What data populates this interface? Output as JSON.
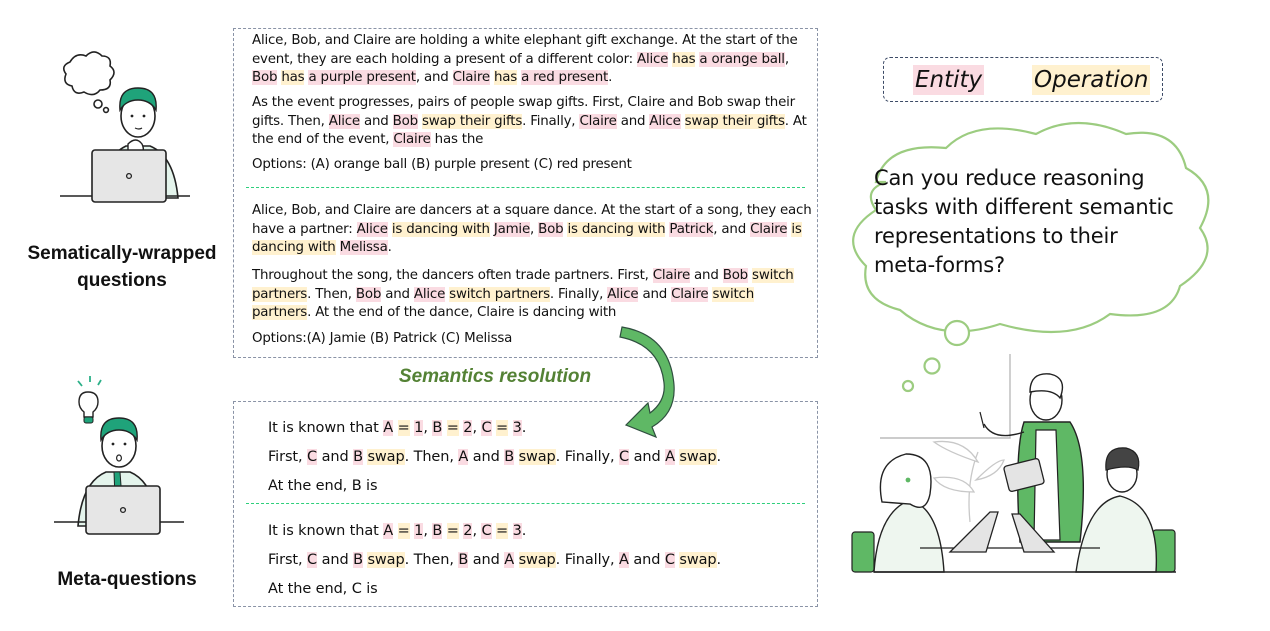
{
  "left_panel": {
    "top_label_line1": "Sematically-wrapped",
    "top_label_line2": "questions",
    "bottom_label": "Meta-questions"
  },
  "highlight_colors": {
    "entity": "#fadbe2",
    "operation": "#fff1cf",
    "separator": "#2ecf7c",
    "arrow": "#5fb865",
    "accent_text": "#548235",
    "cloud_stroke": "#9ccc80"
  },
  "wrapped_questions": {
    "q1": {
      "p1": [
        {
          "t": "Alice, Bob, and Claire are holding a white elephant gift exchange. At the start of the event, they are each holding a present of a different color: ",
          "k": ""
        },
        {
          "t": "Alice",
          "k": "ent"
        },
        {
          "t": " ",
          "k": ""
        },
        {
          "t": "has",
          "k": "op"
        },
        {
          "t": " ",
          "k": ""
        },
        {
          "t": "a orange ball",
          "k": "ent"
        },
        {
          "t": ", ",
          "k": ""
        },
        {
          "t": "Bob",
          "k": "ent"
        },
        {
          "t": " ",
          "k": ""
        },
        {
          "t": "has",
          "k": "op"
        },
        {
          "t": " ",
          "k": ""
        },
        {
          "t": "a purple present",
          "k": "ent"
        },
        {
          "t": ", and ",
          "k": ""
        },
        {
          "t": "Claire",
          "k": "ent"
        },
        {
          "t": " ",
          "k": ""
        },
        {
          "t": "has",
          "k": "op"
        },
        {
          "t": " ",
          "k": ""
        },
        {
          "t": "a red present",
          "k": "ent"
        },
        {
          "t": ".",
          "k": ""
        }
      ],
      "p2": [
        {
          "t": "As the event progresses, pairs of people swap gifts. First, Claire and Bob swap their gifts. Then, ",
          "k": ""
        },
        {
          "t": "Alice",
          "k": "ent"
        },
        {
          "t": " and ",
          "k": ""
        },
        {
          "t": "Bob",
          "k": "ent"
        },
        {
          "t": " ",
          "k": ""
        },
        {
          "t": "swap their gifts",
          "k": "op"
        },
        {
          "t": ". Finally, ",
          "k": ""
        },
        {
          "t": "Claire",
          "k": "ent"
        },
        {
          "t": " and ",
          "k": ""
        },
        {
          "t": "Alice",
          "k": "ent"
        },
        {
          "t": " ",
          "k": ""
        },
        {
          "t": "swap their gifts",
          "k": "op"
        },
        {
          "t": ". At the end of the event, ",
          "k": ""
        },
        {
          "t": "Claire",
          "k": "ent"
        },
        {
          "t": " has the",
          "k": ""
        }
      ],
      "options": "Options: (A) orange ball (B) purple present (C) red present"
    },
    "q2": {
      "p1": [
        {
          "t": "Alice, Bob, and Claire are dancers at a square dance. At the start of a song, they each have a partner: ",
          "k": ""
        },
        {
          "t": "Alice",
          "k": "ent"
        },
        {
          "t": " ",
          "k": ""
        },
        {
          "t": "is dancing with",
          "k": "op"
        },
        {
          "t": " ",
          "k": ""
        },
        {
          "t": "Jamie",
          "k": "ent"
        },
        {
          "t": ", ",
          "k": ""
        },
        {
          "t": "Bob",
          "k": "ent"
        },
        {
          "t": " ",
          "k": ""
        },
        {
          "t": "is dancing with",
          "k": "op"
        },
        {
          "t": " ",
          "k": ""
        },
        {
          "t": "Patrick",
          "k": "ent"
        },
        {
          "t": ", and ",
          "k": ""
        },
        {
          "t": "Claire",
          "k": "ent"
        },
        {
          "t": " ",
          "k": ""
        },
        {
          "t": "is dancing with",
          "k": "op"
        },
        {
          "t": " ",
          "k": ""
        },
        {
          "t": "Melissa",
          "k": "ent"
        },
        {
          "t": ".",
          "k": ""
        }
      ],
      "p2": [
        {
          "t": "Throughout the song, the dancers often trade partners. First, ",
          "k": ""
        },
        {
          "t": "Claire",
          "k": "ent"
        },
        {
          "t": " and ",
          "k": ""
        },
        {
          "t": "Bob",
          "k": "ent"
        },
        {
          "t": " ",
          "k": ""
        },
        {
          "t": "switch partners",
          "k": "op"
        },
        {
          "t": ". Then, ",
          "k": ""
        },
        {
          "t": "Bob",
          "k": "ent"
        },
        {
          "t": " and ",
          "k": ""
        },
        {
          "t": "Alice",
          "k": "ent"
        },
        {
          "t": " ",
          "k": ""
        },
        {
          "t": "switch partners",
          "k": "op"
        },
        {
          "t": ". Finally, ",
          "k": ""
        },
        {
          "t": "Alice",
          "k": "ent"
        },
        {
          "t": " and ",
          "k": ""
        },
        {
          "t": "Claire",
          "k": "ent"
        },
        {
          "t": " ",
          "k": ""
        },
        {
          "t": "switch partners",
          "k": "op"
        },
        {
          "t": ". At the end of the dance, Claire is dancing with",
          "k": ""
        }
      ],
      "options": "Options:(A) Jamie (B) Patrick (C) Melissa"
    }
  },
  "transition_label": "Semantics resolution",
  "meta_questions": {
    "m1": {
      "line1": [
        {
          "t": "It is known that ",
          "k": ""
        },
        {
          "t": "A",
          "k": "ent"
        },
        {
          "t": " ",
          "k": ""
        },
        {
          "t": "=",
          "k": "op"
        },
        {
          "t": " ",
          "k": ""
        },
        {
          "t": "1",
          "k": "ent"
        },
        {
          "t": ", ",
          "k": ""
        },
        {
          "t": "B",
          "k": "ent"
        },
        {
          "t": " ",
          "k": ""
        },
        {
          "t": "=",
          "k": "op"
        },
        {
          "t": " ",
          "k": ""
        },
        {
          "t": "2",
          "k": "ent"
        },
        {
          "t": ", ",
          "k": ""
        },
        {
          "t": "C",
          "k": "ent"
        },
        {
          "t": " ",
          "k": ""
        },
        {
          "t": "=",
          "k": "op"
        },
        {
          "t": " ",
          "k": ""
        },
        {
          "t": "3",
          "k": "ent"
        },
        {
          "t": ".",
          "k": ""
        }
      ],
      "line2": [
        {
          "t": "First, ",
          "k": ""
        },
        {
          "t": "C",
          "k": "ent"
        },
        {
          "t": " and ",
          "k": ""
        },
        {
          "t": "B",
          "k": "ent"
        },
        {
          "t": " ",
          "k": ""
        },
        {
          "t": "swap",
          "k": "op"
        },
        {
          "t": ". Then, ",
          "k": ""
        },
        {
          "t": "A",
          "k": "ent"
        },
        {
          "t": " and ",
          "k": ""
        },
        {
          "t": "B",
          "k": "ent"
        },
        {
          "t": " ",
          "k": ""
        },
        {
          "t": "swap",
          "k": "op"
        },
        {
          "t": ". Finally, ",
          "k": ""
        },
        {
          "t": "C",
          "k": "ent"
        },
        {
          "t": " and ",
          "k": ""
        },
        {
          "t": "A",
          "k": "ent"
        },
        {
          "t": " ",
          "k": ""
        },
        {
          "t": "swap",
          "k": "op"
        },
        {
          "t": ".",
          "k": ""
        }
      ],
      "line3": "At the end, B is"
    },
    "m2": {
      "line1": [
        {
          "t": "It is known that ",
          "k": ""
        },
        {
          "t": "A",
          "k": "ent"
        },
        {
          "t": " ",
          "k": ""
        },
        {
          "t": "=",
          "k": "op"
        },
        {
          "t": " ",
          "k": ""
        },
        {
          "t": "1",
          "k": "ent"
        },
        {
          "t": ", ",
          "k": ""
        },
        {
          "t": "B",
          "k": "ent"
        },
        {
          "t": " ",
          "k": ""
        },
        {
          "t": "=",
          "k": "op"
        },
        {
          "t": " ",
          "k": ""
        },
        {
          "t": "2",
          "k": "ent"
        },
        {
          "t": ", ",
          "k": ""
        },
        {
          "t": "C",
          "k": "ent"
        },
        {
          "t": " ",
          "k": ""
        },
        {
          "t": "=",
          "k": "op"
        },
        {
          "t": " ",
          "k": ""
        },
        {
          "t": "3",
          "k": "ent"
        },
        {
          "t": ".",
          "k": ""
        }
      ],
      "line2": [
        {
          "t": "First, ",
          "k": ""
        },
        {
          "t": "C",
          "k": "ent"
        },
        {
          "t": " and ",
          "k": ""
        },
        {
          "t": "B",
          "k": "ent"
        },
        {
          "t": " ",
          "k": ""
        },
        {
          "t": "swap",
          "k": "op"
        },
        {
          "t": ". Then, ",
          "k": ""
        },
        {
          "t": "B",
          "k": "ent"
        },
        {
          "t": " and ",
          "k": ""
        },
        {
          "t": "A",
          "k": "ent"
        },
        {
          "t": " ",
          "k": ""
        },
        {
          "t": "swap",
          "k": "op"
        },
        {
          "t": ". Finally, ",
          "k": ""
        },
        {
          "t": "A",
          "k": "ent"
        },
        {
          "t": " and ",
          "k": ""
        },
        {
          "t": "C",
          "k": "ent"
        },
        {
          "t": " ",
          "k": ""
        },
        {
          "t": "swap",
          "k": "op"
        },
        {
          "t": ".",
          "k": ""
        }
      ],
      "line3": "At the end, C is"
    }
  },
  "legend": {
    "entity_label": "Entity",
    "operation_label": "Operation"
  },
  "thought_cloud": {
    "text": "Can you reduce reasoning tasks with different semantic representations to their meta-forms?"
  },
  "icons": {
    "top_person": "thinking-person-with-laptop",
    "bottom_person": "enlightened-person-with-laptop",
    "lightbulb": "lightbulb-icon",
    "meeting": "team-meeting-illustration",
    "arrow": "curved-arrow"
  }
}
